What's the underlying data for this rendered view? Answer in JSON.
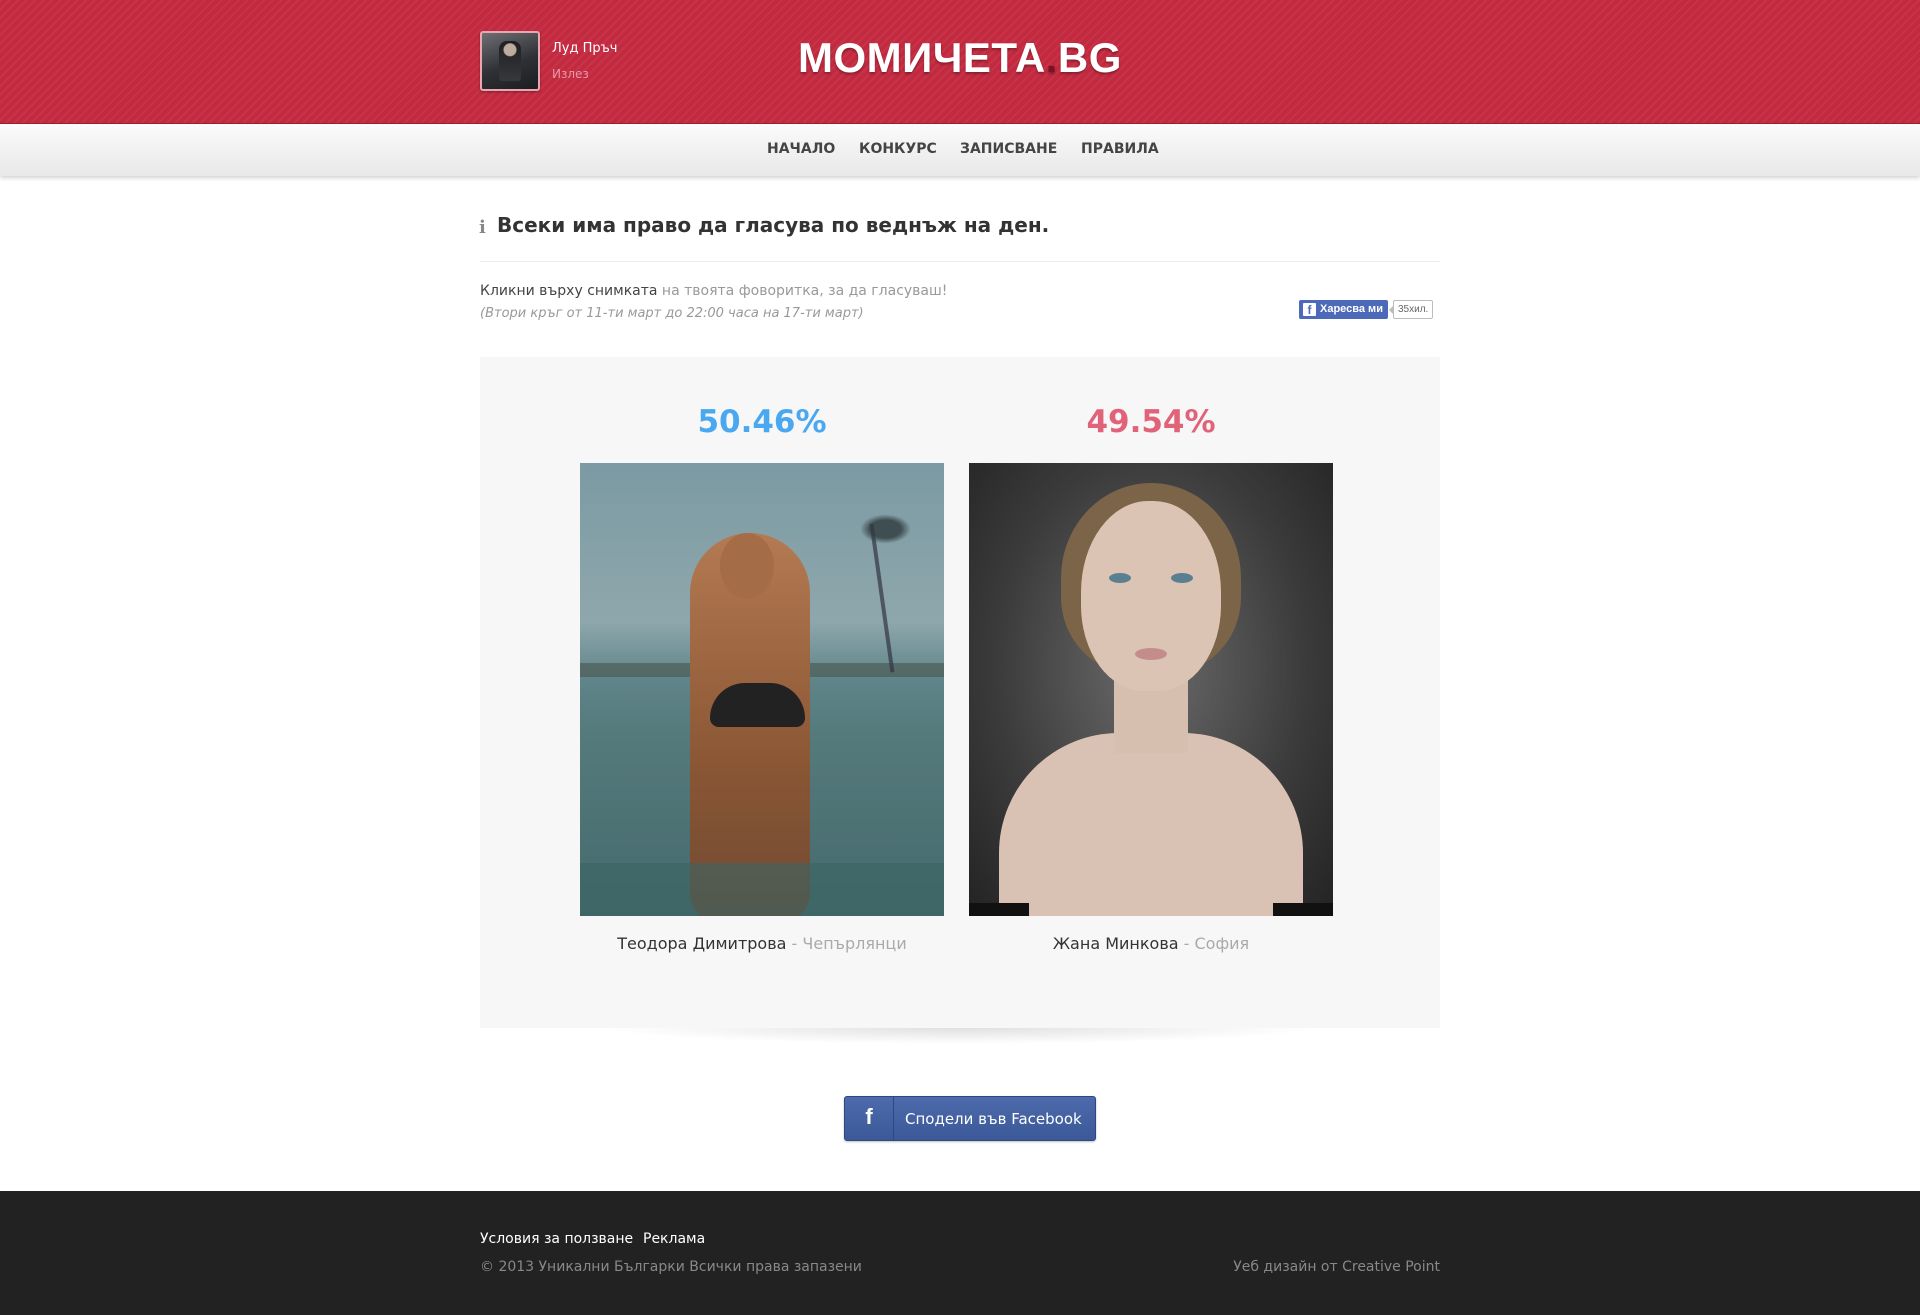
{
  "header": {
    "user_name": "Луд Пръч",
    "logout_label": "Излез",
    "logo_main": "МОМИЧЕТА",
    "logo_dot": ".",
    "logo_tld": "BG"
  },
  "nav": {
    "items": [
      {
        "label": "НАЧАЛО"
      },
      {
        "label": "КОНКУРС"
      },
      {
        "label": "ЗАПИСВАНЕ"
      },
      {
        "label": "ПРАВИЛА"
      }
    ]
  },
  "notice": {
    "icon": "info-icon",
    "text": "Всеки има право да гласува по веднъж на ден."
  },
  "instructions": {
    "strong": "Кликни върху снимката",
    "rest": " на твоята фоворитка, за да гласуваш!",
    "dates": "(Втори кръг от 11-ти март до 22:00 часа на 17-ти март)"
  },
  "facebook_like": {
    "label": "Харесва ми",
    "count": "35хил."
  },
  "contestants": [
    {
      "percent": "50.46%",
      "name": "Теодора Димитрова",
      "city": " - Чепърлянци",
      "color": "#4aa8f0"
    },
    {
      "percent": "49.54%",
      "name": "Жана Минкова",
      "city": " - София",
      "color": "#e0637a"
    }
  ],
  "share": {
    "label": "Сподели във Facebook"
  },
  "footer": {
    "links": [
      {
        "label": "Условия за ползване"
      },
      {
        "label": "Реклама"
      }
    ],
    "copyright": "© 2013 Уникални Българки Всички права запазени",
    "credit": "Уеб дизайн от Creative Point"
  },
  "colors": {
    "brand_red": "#c3293f",
    "facebook_blue": "#3b5998",
    "footer_bg": "#222222"
  }
}
